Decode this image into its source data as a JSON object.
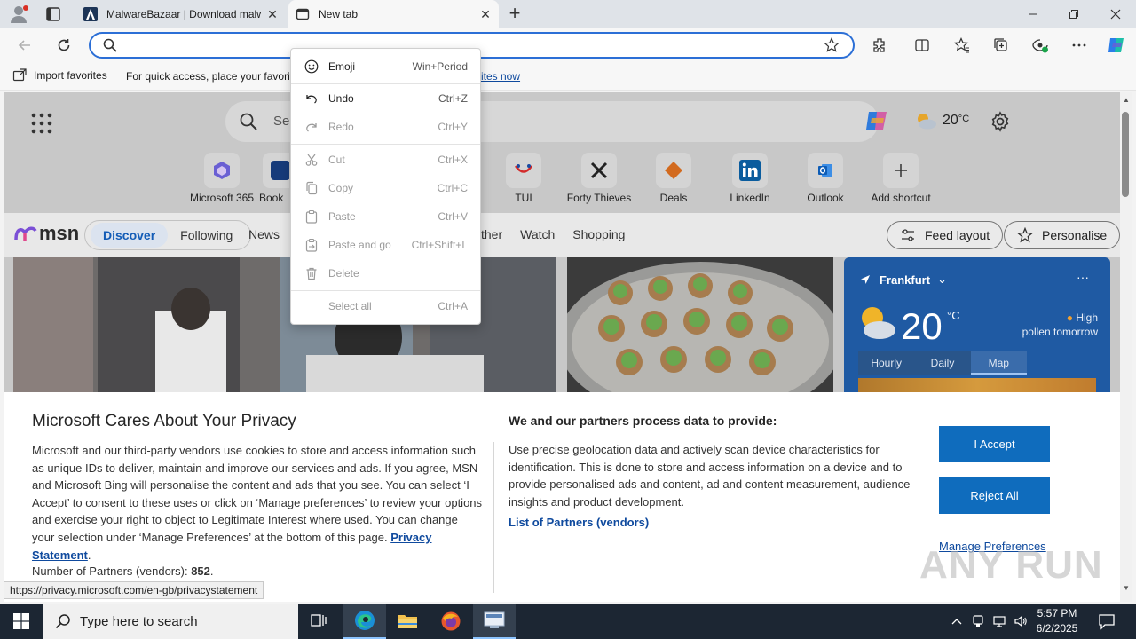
{
  "tabs": [
    {
      "title": "MalwareBazaar | Download malw",
      "favicon": "malwarebazaar-logo"
    },
    {
      "title": "New tab",
      "favicon": "newtab-icon"
    }
  ],
  "addressbar": {
    "value": "",
    "placeholder": ""
  },
  "favorites_bar": {
    "import_label": "Import favorites",
    "hint": "For quick access, place your favorit",
    "link": "rites now"
  },
  "msn": {
    "search_placeholder": "Se",
    "weather_temp": "20",
    "weather_unit": "°C",
    "shortcuts": [
      {
        "label": "Microsoft 365",
        "icon": "m365-icon"
      },
      {
        "label": "Book",
        "icon": "booking-icon"
      },
      {
        "label": "TUI",
        "icon": "tui-icon"
      },
      {
        "label": "Forty Thieves",
        "icon": "forty-thieves-icon"
      },
      {
        "label": "Deals",
        "icon": "deals-icon"
      },
      {
        "label": "LinkedIn",
        "icon": "linkedin-icon"
      },
      {
        "label": "Outlook",
        "icon": "outlook-icon"
      },
      {
        "label": "Add shortcut",
        "icon": "plus-icon"
      }
    ],
    "logo": "msn",
    "nav": {
      "discover": "Discover",
      "following": "Following"
    },
    "nav_rest": [
      "News"
    ],
    "nav_rest2": [
      "ther",
      "Watch",
      "Shopping"
    ],
    "feed_layout": "Feed layout",
    "personalise": "Personalise"
  },
  "weather_card": {
    "location": "Frankfurt",
    "more": "···",
    "temp": "20",
    "unit": "°C",
    "pollen_level": "High",
    "pollen_when": "pollen tomorrow",
    "tabs": [
      "Hourly",
      "Daily",
      "Map"
    ]
  },
  "context_menu": [
    {
      "label": "Emoji",
      "shortcut": "Win+Period",
      "icon": "emoji-icon",
      "enabled": true
    },
    {
      "label": "Undo",
      "shortcut": "Ctrl+Z",
      "icon": "undo-icon",
      "enabled": true
    },
    {
      "label": "Redo",
      "shortcut": "Ctrl+Y",
      "icon": "redo-icon",
      "enabled": false
    },
    {
      "label": "Cut",
      "shortcut": "Ctrl+X",
      "icon": "cut-icon",
      "enabled": false
    },
    {
      "label": "Copy",
      "shortcut": "Ctrl+C",
      "icon": "copy-icon",
      "enabled": false
    },
    {
      "label": "Paste",
      "shortcut": "Ctrl+V",
      "icon": "paste-icon",
      "enabled": false
    },
    {
      "label": "Paste and go",
      "shortcut": "Ctrl+Shift+L",
      "icon": "paste-go-icon",
      "enabled": false
    },
    {
      "label": "Delete",
      "shortcut": "",
      "icon": "delete-icon",
      "enabled": false
    },
    {
      "label": "Select all",
      "shortcut": "Ctrl+A",
      "icon": "",
      "enabled": false
    }
  ],
  "privacy": {
    "title": "Microsoft Cares About Your Privacy",
    "body": "Microsoft and our third-party vendors use cookies to store and access information such as unique IDs to deliver, maintain and improve our services and ads. If you agree, MSN and Microsoft Bing will personalise the content and ads that you see. You can select ‘I Accept’ to consent to these uses or click on ‘Manage preferences’ to review your options and exercise your right to object to Legitimate Interest where used.  You can change your selection under ‘Manage Preferences’ at the bottom of this page.",
    "privacy_link": "Privacy Statement",
    "partners_label": "Number of Partners (vendors):",
    "partners_count": "852",
    "right_title": "We and our partners process data to provide:",
    "right_body": "Use precise geolocation data and actively scan device characteristics for identification. This is done to store and access information on a device and to provide personalised ads and content, ad and content measurement, audience insights and product development.",
    "partners_link": "List of Partners (vendors)",
    "accept": "I Accept",
    "reject": "Reject All",
    "manage": "Manage Preferences"
  },
  "status_url": "https://privacy.microsoft.com/en-gb/privacystatement",
  "watermark": "ANY RUN",
  "taskbar": {
    "search_placeholder": "Type here to search",
    "time": "5:57 PM",
    "date": "6/2/2025"
  },
  "colors": {
    "accent": "#0f6cbd",
    "link": "#0f4a9e",
    "weather_card": "#1f5aa3",
    "taskbar": "#1c2633"
  }
}
